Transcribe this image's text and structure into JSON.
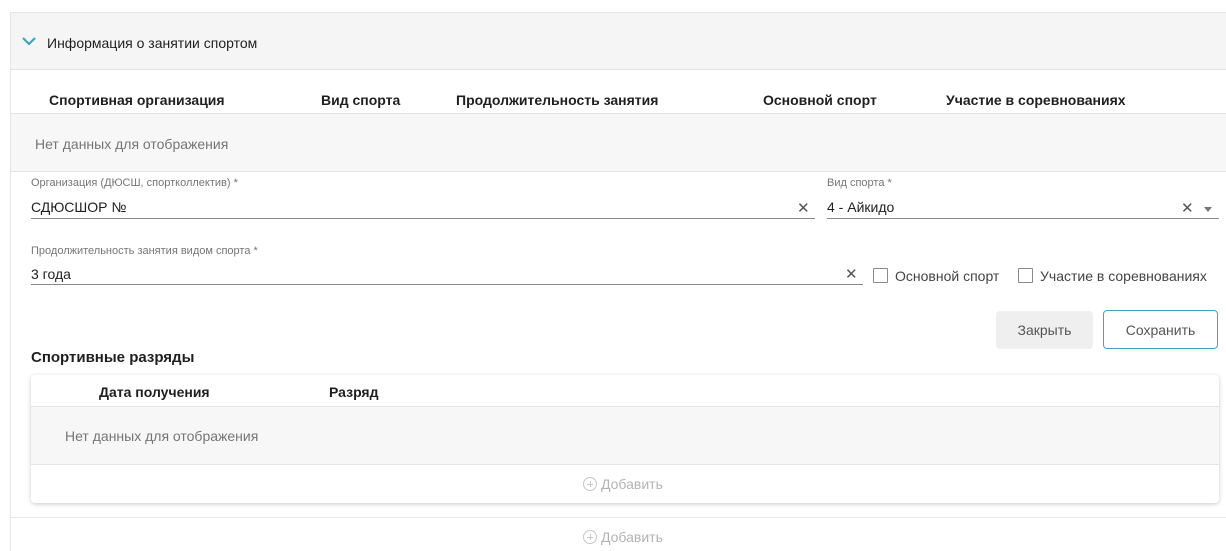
{
  "section": {
    "title": "Информация о занятии спортом",
    "expand_icon": "chevron-down-icon"
  },
  "sports_table": {
    "columns": [
      "Спортивная организация",
      "Вид спорта",
      "Продолжительность занятия",
      "Основной спорт",
      "Участие в соревнованиях"
    ],
    "empty_text": "Нет данных для отображения"
  },
  "form": {
    "organization": {
      "label": "Организация (ДЮСШ, спортколлектив) *",
      "value": "СДЮСШОР №",
      "clear_icon": "close-icon"
    },
    "sport_type": {
      "label": "Вид спорта *",
      "value": "4 - Айкидо",
      "clear_icon": "close-icon",
      "dropdown_icon": "caret-down-icon"
    },
    "duration": {
      "label": "Продолжительность занятия видом спорта *",
      "value": "3 года",
      "clear_icon": "close-icon"
    },
    "main_sport": {
      "label": "Основной спорт",
      "checked": false
    },
    "competitions": {
      "label": "Участие в соревнованиях",
      "checked": false
    },
    "close_label": "Закрыть",
    "save_label": "Сохранить"
  },
  "ranks": {
    "title": "Спортивные разряды",
    "columns": [
      "Дата получения",
      "Разряд"
    ],
    "empty_text": "Нет данных для отображения",
    "add_label": "Добавить",
    "add_icon": "plus-circle-icon"
  },
  "footer": {
    "add_label": "Добавить",
    "add_icon": "plus-circle-icon"
  },
  "colors": {
    "accent": "#3ea6bd",
    "header_bg": "#f5f5f5",
    "muted_text": "#757575",
    "disabled_text": "#b3b3b3"
  }
}
